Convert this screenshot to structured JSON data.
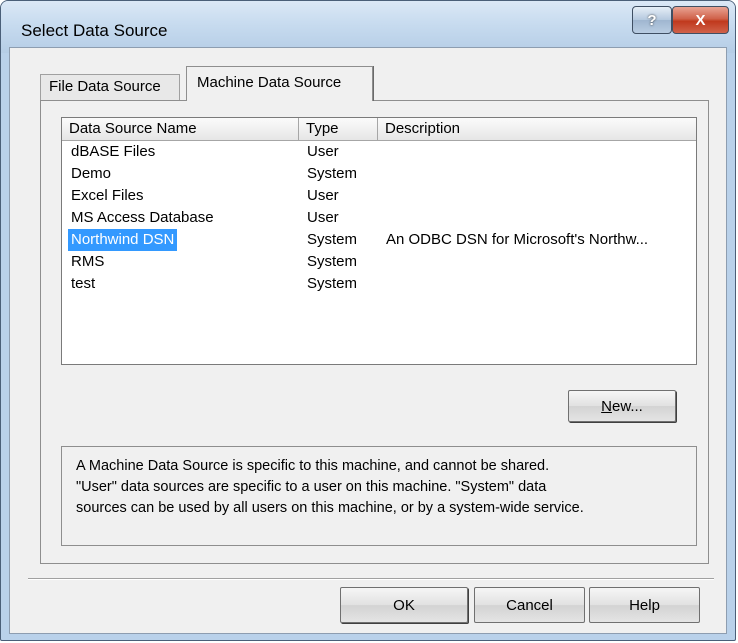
{
  "window": {
    "title": "Select Data Source",
    "title_buttons": {
      "help": "?",
      "close": "X"
    }
  },
  "tabs": [
    {
      "label": "File Data Source",
      "active": false
    },
    {
      "label": "Machine Data Source",
      "active": true
    }
  ],
  "list": {
    "columns": [
      "Data Source Name",
      "Type",
      "Description"
    ],
    "rows": [
      {
        "name": "dBASE Files",
        "type": "User",
        "description": ""
      },
      {
        "name": "Demo",
        "type": "System",
        "description": ""
      },
      {
        "name": "Excel Files",
        "type": "User",
        "description": ""
      },
      {
        "name": "MS Access Database",
        "type": "User",
        "description": ""
      },
      {
        "name": "Northwind DSN",
        "type": "System",
        "description": "An ODBC DSN for Microsoft's Northw...",
        "selected": true
      },
      {
        "name": "RMS",
        "type": "System",
        "description": ""
      },
      {
        "name": "test",
        "type": "System",
        "description": ""
      }
    ]
  },
  "buttons": {
    "new": "New...",
    "ok": "OK",
    "cancel": "Cancel",
    "help": "Help"
  },
  "info_lines": [
    "A Machine Data Source is specific to this machine, and cannot be shared.",
    "\"User\" data sources are specific to a user on this machine.  \"System\" data",
    "sources can be used by all users on this machine, or by a system-wide service."
  ],
  "colors": {
    "selection": "#3399ff",
    "close_button": "#c0391d",
    "frame": "#b9d1ea"
  }
}
